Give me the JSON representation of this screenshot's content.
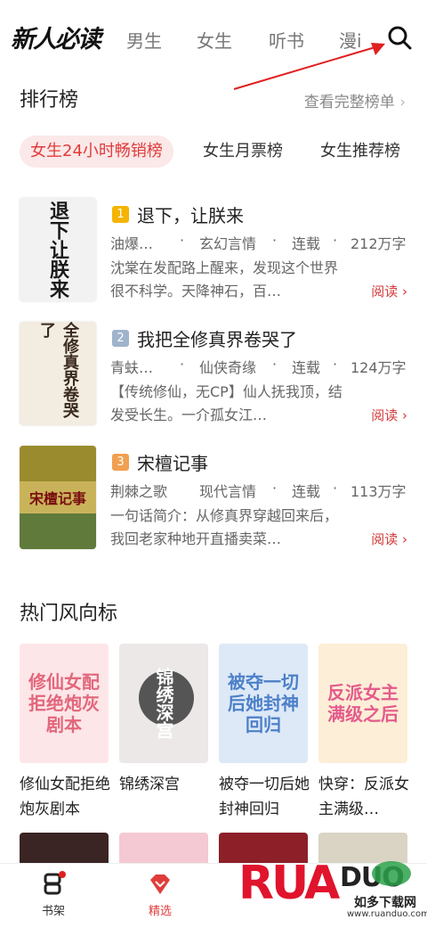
{
  "nav": {
    "logo": "新人必读",
    "tabs": [
      "男生",
      "女生",
      "听书",
      "漫i"
    ],
    "search_icon": "search-icon"
  },
  "ranking": {
    "title": "排行榜",
    "see_all": "查看完整榜单",
    "tabs": [
      "女生24小时畅销榜",
      "女生月票榜",
      "女生推荐榜"
    ],
    "active_tab": 0
  },
  "books": [
    {
      "rank": "1",
      "rank_color": "#f4b400",
      "title": "退下，让朕来",
      "author": "油爆…",
      "category": "玄幻言情",
      "status": "连载",
      "words": "212万字",
      "desc": "沈棠在发配路上醒来，发现这个世界很不科学。天降神石，百…",
      "read": "阅读",
      "cover_text": "退下让朕来",
      "cover_bg": "#f2f2f2",
      "cover_fg": "#1a1a1a"
    },
    {
      "rank": "2",
      "rank_color": "#9fb3cc",
      "title": "我把全修真界卷哭了",
      "author": "青蚨…",
      "category": "仙侠奇缘",
      "status": "连载",
      "words": "124万字",
      "desc": "【传统修仙，无CP】仙人抚我顶，结发受长生。一介孤女江…",
      "read": "阅读",
      "cover_text": "全修真界卷哭了",
      "cover_bg": "#f3ece0",
      "cover_fg": "#3a2a1e"
    },
    {
      "rank": "3",
      "rank_color": "#f0a050",
      "title": "宋檀记事",
      "author": "荆棘之歌",
      "category": "现代言情",
      "status": "连载",
      "words": "113万字",
      "desc": "一句话简介：从修真界穿越回来后，我回老家种地开直播卖菜…",
      "read": "阅读",
      "cover_text": "宋檀记事",
      "cover_bg": "#c9b35a",
      "cover_fg": "#7a1010"
    }
  ],
  "hot": {
    "title": "热门风向标",
    "items": [
      {
        "name": "修仙女配拒绝炮灰剧本",
        "cover_text": "修仙女配拒绝炮灰剧本",
        "bg": "#fde6e8",
        "fg": "#e2677c"
      },
      {
        "name": "锦绣深宫",
        "cover_text": "锦绣深宫",
        "bg": "#ece8e8",
        "fg": "#333333"
      },
      {
        "name": "被夺一切后她封神回归",
        "cover_text": "被夺一切后她封神回归",
        "bg": "#dde9f7",
        "fg": "#4d80c9"
      },
      {
        "name": "快穿：反派女主满级…",
        "cover_text": "反派女主满级之后",
        "bg": "#fdeed7",
        "fg": "#e45b8c"
      }
    ],
    "row2_colors": [
      "#3a2424",
      "#f5c9d4",
      "#d9d4c4",
      "#8c1f28"
    ]
  },
  "bottom": {
    "shelf": "书架",
    "selected": "精选"
  },
  "watermark": {
    "brand": "RUANDUO",
    "sub": "如多下载网",
    "url": "www.ruanduo.com"
  }
}
